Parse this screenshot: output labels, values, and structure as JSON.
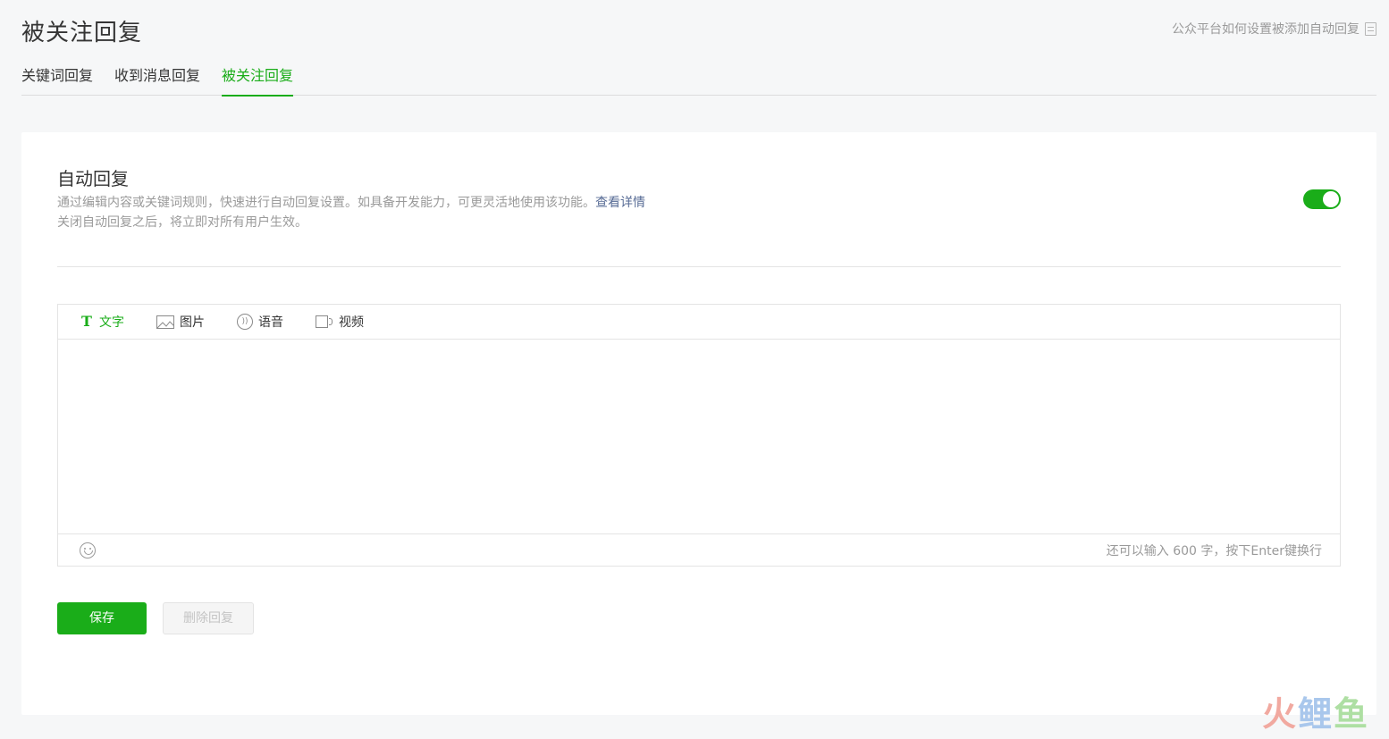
{
  "page": {
    "title": "被关注回复",
    "help_link": "公众平台如何设置被添加自动回复"
  },
  "tabs": [
    {
      "label": "关键词回复"
    },
    {
      "label": "收到消息回复"
    },
    {
      "label": "被关注回复",
      "active": true
    }
  ],
  "auto_reply": {
    "title": "自动回复",
    "desc_line1": "通过编辑内容或关键词规则，快速进行自动回复设置。如具备开发能力，可更灵活地使用该功能。",
    "desc_link": "查看详情",
    "desc_line2": "关闭自动回复之后，将立即对所有用户生效。",
    "enabled": true
  },
  "editor": {
    "tabs": [
      {
        "label": "文字",
        "icon": "text-icon",
        "active": true
      },
      {
        "label": "图片",
        "icon": "image-icon"
      },
      {
        "label": "语音",
        "icon": "voice-icon"
      },
      {
        "label": "视频",
        "icon": "video-icon"
      }
    ],
    "content": "",
    "counter_text": "还可以输入 600 字，按下Enter键换行"
  },
  "buttons": {
    "save": "保存",
    "delete": "删除回复"
  },
  "watermark": {
    "char1": "火",
    "char2": "鲤",
    "char3": "鱼"
  },
  "colors": {
    "accent": "#1aad19",
    "link": "#576b95"
  }
}
